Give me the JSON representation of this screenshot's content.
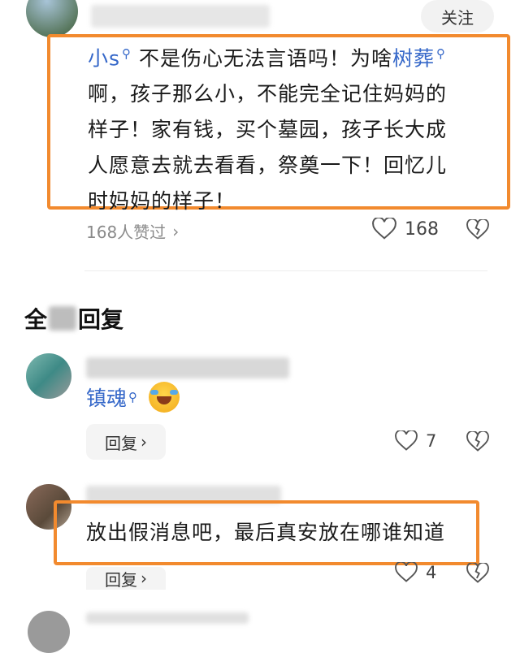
{
  "top_comment": {
    "follow_label": "关注",
    "line1_prefix": "小s",
    "line1_mid": " 不是伤心无法言语吗！为啥",
    "line1_link": "树葬",
    "line2": "啊，孩子那么小，不能完全记住妈妈的",
    "line3": "样子！家有钱，买个墓园，孩子长大成",
    "line4": "人愿意去就去看看，祭奠一下！回忆儿",
    "line5": "时妈妈的样子！",
    "likes_text": "168人赞过",
    "like_count": "168"
  },
  "replies_header": {
    "left": "全",
    "right": "回复"
  },
  "reply1": {
    "link_text": "镇魂",
    "reply_label": "回复",
    "like_count": "7"
  },
  "reply2": {
    "text": "放出假消息吧，最后真安放在哪谁知道",
    "reply_label": "回复",
    "like_count": "4"
  },
  "colors": {
    "highlight": "#f28a2e",
    "link": "#3668c9"
  }
}
